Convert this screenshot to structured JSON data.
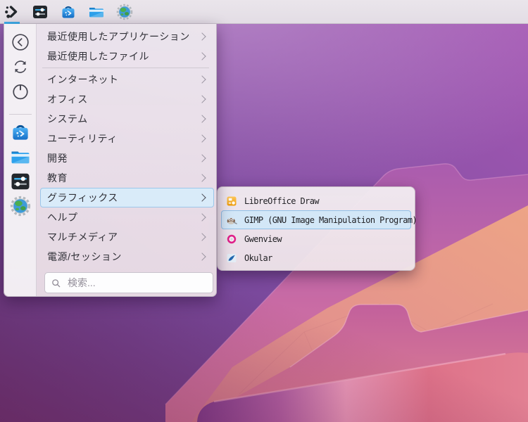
{
  "panel": {
    "items": [
      {
        "name": "application-launcher",
        "active": true
      },
      {
        "name": "system-settings-sliders",
        "active": false
      },
      {
        "name": "discover-store",
        "active": false
      },
      {
        "name": "dolphin-file-manager",
        "active": false
      },
      {
        "name": "system-globe",
        "active": false
      }
    ]
  },
  "menu": {
    "sidebar": {
      "top": [
        {
          "name": "back"
        },
        {
          "name": "refresh"
        },
        {
          "name": "power"
        }
      ],
      "bottom": [
        {
          "name": "discover"
        },
        {
          "name": "file-manager"
        },
        {
          "name": "system-settings"
        },
        {
          "name": "system-globe"
        }
      ]
    },
    "items": [
      {
        "label": "最近使用したアプリケーション",
        "highlighted": false
      },
      {
        "label": "最近使用したファイル",
        "highlighted": false
      },
      {
        "label": "インターネット",
        "highlighted": false
      },
      {
        "label": "オフィス",
        "highlighted": false
      },
      {
        "label": "システム",
        "highlighted": false
      },
      {
        "label": "ユーティリティ",
        "highlighted": false
      },
      {
        "label": "開発",
        "highlighted": false
      },
      {
        "label": "教育",
        "highlighted": false
      },
      {
        "label": "グラフィックス",
        "highlighted": true
      },
      {
        "label": "ヘルプ",
        "highlighted": false
      },
      {
        "label": "マルチメディア",
        "highlighted": false
      },
      {
        "label": "電源/セッション",
        "highlighted": false
      }
    ],
    "separator_after_index": 1,
    "search_placeholder": "検索..."
  },
  "submenu": {
    "items": [
      {
        "label": "LibreOffice Draw",
        "icon": "libreoffice-draw",
        "highlighted": false
      },
      {
        "label": "GIMP (GNU Image Manipulation Program)",
        "icon": "gimp-wilber",
        "highlighted": true
      },
      {
        "label": "Gwenview",
        "icon": "gwenview",
        "highlighted": false
      },
      {
        "label": "Okular",
        "icon": "okular",
        "highlighted": false
      }
    ]
  },
  "colors": {
    "accent": "#3daee9",
    "highlight_bg": "#d9ebf9",
    "highlight_border": "#9cc7ea",
    "panel_bg": "#e7e1e8",
    "wallpaper_purple": "#7b4a9e",
    "wallpaper_magenta": "#c2609c",
    "wallpaper_salmon": "#eda486"
  }
}
